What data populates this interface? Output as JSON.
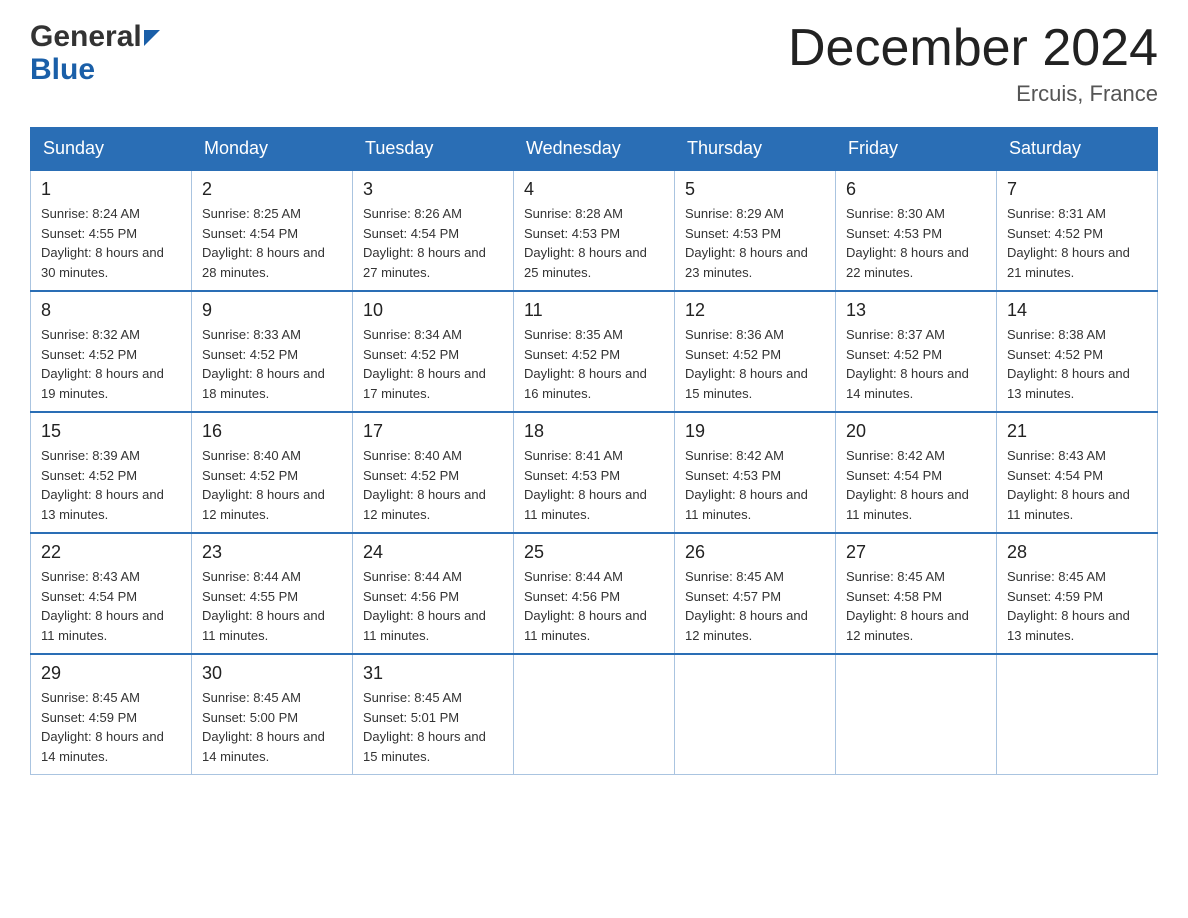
{
  "header": {
    "logo_general": "General",
    "logo_blue": "Blue",
    "month_title": "December 2024",
    "location": "Ercuis, France"
  },
  "calendar": {
    "days_of_week": [
      "Sunday",
      "Monday",
      "Tuesday",
      "Wednesday",
      "Thursday",
      "Friday",
      "Saturday"
    ],
    "weeks": [
      [
        {
          "date": "1",
          "sunrise": "8:24 AM",
          "sunset": "4:55 PM",
          "daylight": "8 hours and 30 minutes."
        },
        {
          "date": "2",
          "sunrise": "8:25 AM",
          "sunset": "4:54 PM",
          "daylight": "8 hours and 28 minutes."
        },
        {
          "date": "3",
          "sunrise": "8:26 AM",
          "sunset": "4:54 PM",
          "daylight": "8 hours and 27 minutes."
        },
        {
          "date": "4",
          "sunrise": "8:28 AM",
          "sunset": "4:53 PM",
          "daylight": "8 hours and 25 minutes."
        },
        {
          "date": "5",
          "sunrise": "8:29 AM",
          "sunset": "4:53 PM",
          "daylight": "8 hours and 23 minutes."
        },
        {
          "date": "6",
          "sunrise": "8:30 AM",
          "sunset": "4:53 PM",
          "daylight": "8 hours and 22 minutes."
        },
        {
          "date": "7",
          "sunrise": "8:31 AM",
          "sunset": "4:52 PM",
          "daylight": "8 hours and 21 minutes."
        }
      ],
      [
        {
          "date": "8",
          "sunrise": "8:32 AM",
          "sunset": "4:52 PM",
          "daylight": "8 hours and 19 minutes."
        },
        {
          "date": "9",
          "sunrise": "8:33 AM",
          "sunset": "4:52 PM",
          "daylight": "8 hours and 18 minutes."
        },
        {
          "date": "10",
          "sunrise": "8:34 AM",
          "sunset": "4:52 PM",
          "daylight": "8 hours and 17 minutes."
        },
        {
          "date": "11",
          "sunrise": "8:35 AM",
          "sunset": "4:52 PM",
          "daylight": "8 hours and 16 minutes."
        },
        {
          "date": "12",
          "sunrise": "8:36 AM",
          "sunset": "4:52 PM",
          "daylight": "8 hours and 15 minutes."
        },
        {
          "date": "13",
          "sunrise": "8:37 AM",
          "sunset": "4:52 PM",
          "daylight": "8 hours and 14 minutes."
        },
        {
          "date": "14",
          "sunrise": "8:38 AM",
          "sunset": "4:52 PM",
          "daylight": "8 hours and 13 minutes."
        }
      ],
      [
        {
          "date": "15",
          "sunrise": "8:39 AM",
          "sunset": "4:52 PM",
          "daylight": "8 hours and 13 minutes."
        },
        {
          "date": "16",
          "sunrise": "8:40 AM",
          "sunset": "4:52 PM",
          "daylight": "8 hours and 12 minutes."
        },
        {
          "date": "17",
          "sunrise": "8:40 AM",
          "sunset": "4:52 PM",
          "daylight": "8 hours and 12 minutes."
        },
        {
          "date": "18",
          "sunrise": "8:41 AM",
          "sunset": "4:53 PM",
          "daylight": "8 hours and 11 minutes."
        },
        {
          "date": "19",
          "sunrise": "8:42 AM",
          "sunset": "4:53 PM",
          "daylight": "8 hours and 11 minutes."
        },
        {
          "date": "20",
          "sunrise": "8:42 AM",
          "sunset": "4:54 PM",
          "daylight": "8 hours and 11 minutes."
        },
        {
          "date": "21",
          "sunrise": "8:43 AM",
          "sunset": "4:54 PM",
          "daylight": "8 hours and 11 minutes."
        }
      ],
      [
        {
          "date": "22",
          "sunrise": "8:43 AM",
          "sunset": "4:54 PM",
          "daylight": "8 hours and 11 minutes."
        },
        {
          "date": "23",
          "sunrise": "8:44 AM",
          "sunset": "4:55 PM",
          "daylight": "8 hours and 11 minutes."
        },
        {
          "date": "24",
          "sunrise": "8:44 AM",
          "sunset": "4:56 PM",
          "daylight": "8 hours and 11 minutes."
        },
        {
          "date": "25",
          "sunrise": "8:44 AM",
          "sunset": "4:56 PM",
          "daylight": "8 hours and 11 minutes."
        },
        {
          "date": "26",
          "sunrise": "8:45 AM",
          "sunset": "4:57 PM",
          "daylight": "8 hours and 12 minutes."
        },
        {
          "date": "27",
          "sunrise": "8:45 AM",
          "sunset": "4:58 PM",
          "daylight": "8 hours and 12 minutes."
        },
        {
          "date": "28",
          "sunrise": "8:45 AM",
          "sunset": "4:59 PM",
          "daylight": "8 hours and 13 minutes."
        }
      ],
      [
        {
          "date": "29",
          "sunrise": "8:45 AM",
          "sunset": "4:59 PM",
          "daylight": "8 hours and 14 minutes."
        },
        {
          "date": "30",
          "sunrise": "8:45 AM",
          "sunset": "5:00 PM",
          "daylight": "8 hours and 14 minutes."
        },
        {
          "date": "31",
          "sunrise": "8:45 AM",
          "sunset": "5:01 PM",
          "daylight": "8 hours and 15 minutes."
        },
        null,
        null,
        null,
        null
      ]
    ]
  }
}
